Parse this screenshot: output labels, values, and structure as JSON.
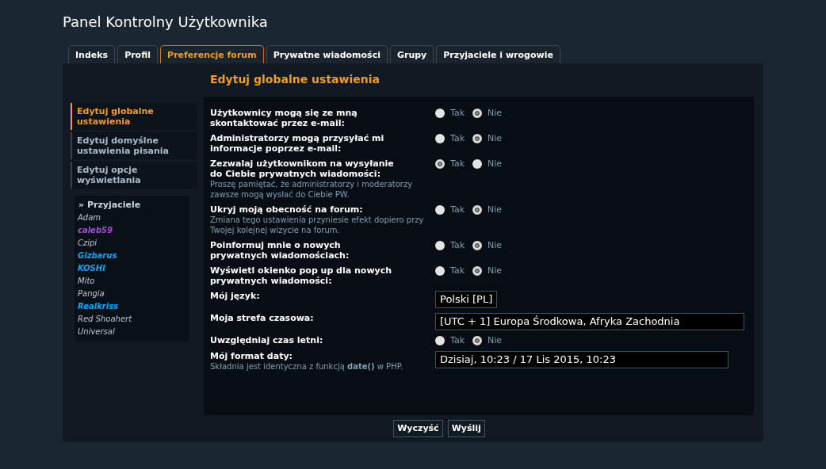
{
  "page_title": "Panel Kontrolny Użytkownika",
  "tabs": [
    {
      "label": "Indeks",
      "selected": false
    },
    {
      "label": "Profil",
      "selected": false
    },
    {
      "label": "Preferencje forum",
      "selected": true
    },
    {
      "label": "Prywatne wiadomości",
      "selected": false
    },
    {
      "label": "Grupy",
      "selected": false
    },
    {
      "label": "Przyjaciele i wrogowie",
      "selected": false
    }
  ],
  "sidebar": {
    "items": [
      {
        "label": "Edytuj globalne ustawienia",
        "selected": true
      },
      {
        "label": "Edytuj domyślne ustawienia pisania",
        "selected": false
      },
      {
        "label": "Edytuj opcje wyświetlania",
        "selected": false
      }
    ],
    "friends": {
      "title": "» Przyjaciele",
      "items": [
        {
          "name": "Adam",
          "color": "#b8c6d4",
          "bold": false
        },
        {
          "name": "caleb59",
          "color": "#a050d0",
          "bold": true
        },
        {
          "name": "Czipi",
          "color": "#b8c6d4",
          "bold": false
        },
        {
          "name": "Gizbarus",
          "color": "#00aaff",
          "bold": true
        },
        {
          "name": "KOSHI",
          "color": "#00aaff",
          "bold": true
        },
        {
          "name": "Mito",
          "color": "#b8c6d4",
          "bold": false
        },
        {
          "name": "Pangia",
          "color": "#b8c6d4",
          "bold": false
        },
        {
          "name": "Realkriss",
          "color": "#00aaff",
          "bold": true
        },
        {
          "name": "Red Shoahert",
          "color": "#b8c6d4",
          "bold": false
        },
        {
          "name": "Universal",
          "color": "#b8c6d4",
          "bold": false
        }
      ]
    }
  },
  "section_title": "Edytuj globalne ustawienia",
  "settings": [
    {
      "kind": "radio",
      "label": "Użytkownicy mogą się ze mną skontaktować przez e-mail:",
      "options": [
        {
          "label": "Tak",
          "selected": false
        },
        {
          "label": "Nie",
          "selected": true
        }
      ]
    },
    {
      "kind": "radio",
      "label": "Administratorzy mogą przysyłać mi informacje poprzez e-mail:",
      "options": [
        {
          "label": "Tak",
          "selected": false
        },
        {
          "label": "Nie",
          "selected": true
        }
      ]
    },
    {
      "kind": "radio",
      "label": "Zezwalaj użytkownikom na wysyłanie do Ciebie prywatnych wiadomości:",
      "hint": "Proszę pamiętać, że administratorzy i moderatorzy zawsze mogą wysłać do Ciebie PW.",
      "options": [
        {
          "label": "Tak",
          "selected": true
        },
        {
          "label": "Nie",
          "selected": false
        }
      ]
    },
    {
      "kind": "radio",
      "label": "Ukryj moją obecność na forum:",
      "hint": "Zmiana tego ustawienia przyniesie efekt dopiero przy Twojej kolejnej wizycie na forum.",
      "options": [
        {
          "label": "Tak",
          "selected": false
        },
        {
          "label": "Nie",
          "selected": true
        }
      ]
    },
    {
      "kind": "radio",
      "label": "Poinformuj mnie o nowych prywatnych wiadomościach:",
      "options": [
        {
          "label": "Tak",
          "selected": false
        },
        {
          "label": "Nie",
          "selected": true
        }
      ]
    },
    {
      "kind": "radio",
      "label": "Wyświetl okienko pop up dla nowych prywatnych wiadomości:",
      "options": [
        {
          "label": "Tak",
          "selected": false
        },
        {
          "label": "Nie",
          "selected": true
        }
      ]
    },
    {
      "kind": "select",
      "label": "Mój język:",
      "value": "Polski [PL]"
    },
    {
      "kind": "select",
      "label": "Moja strefa czasowa:",
      "value": "[UTC + 1] Europa Środkowa, Afryka Zachodnia"
    },
    {
      "kind": "radio",
      "label": "Uwzględniaj czas letni:",
      "options": [
        {
          "label": "Tak",
          "selected": false
        },
        {
          "label": "Nie",
          "selected": true
        }
      ]
    },
    {
      "kind": "text",
      "label": "Mój format daty:",
      "hint": "Składnia jest identyczna z funkcją **date()** w PHP.",
      "value": "Dzisiaj, 10:23 / 17 Lis 2015, 10:23"
    }
  ],
  "buttons": [
    "Wyczyść",
    "Wyślij"
  ]
}
